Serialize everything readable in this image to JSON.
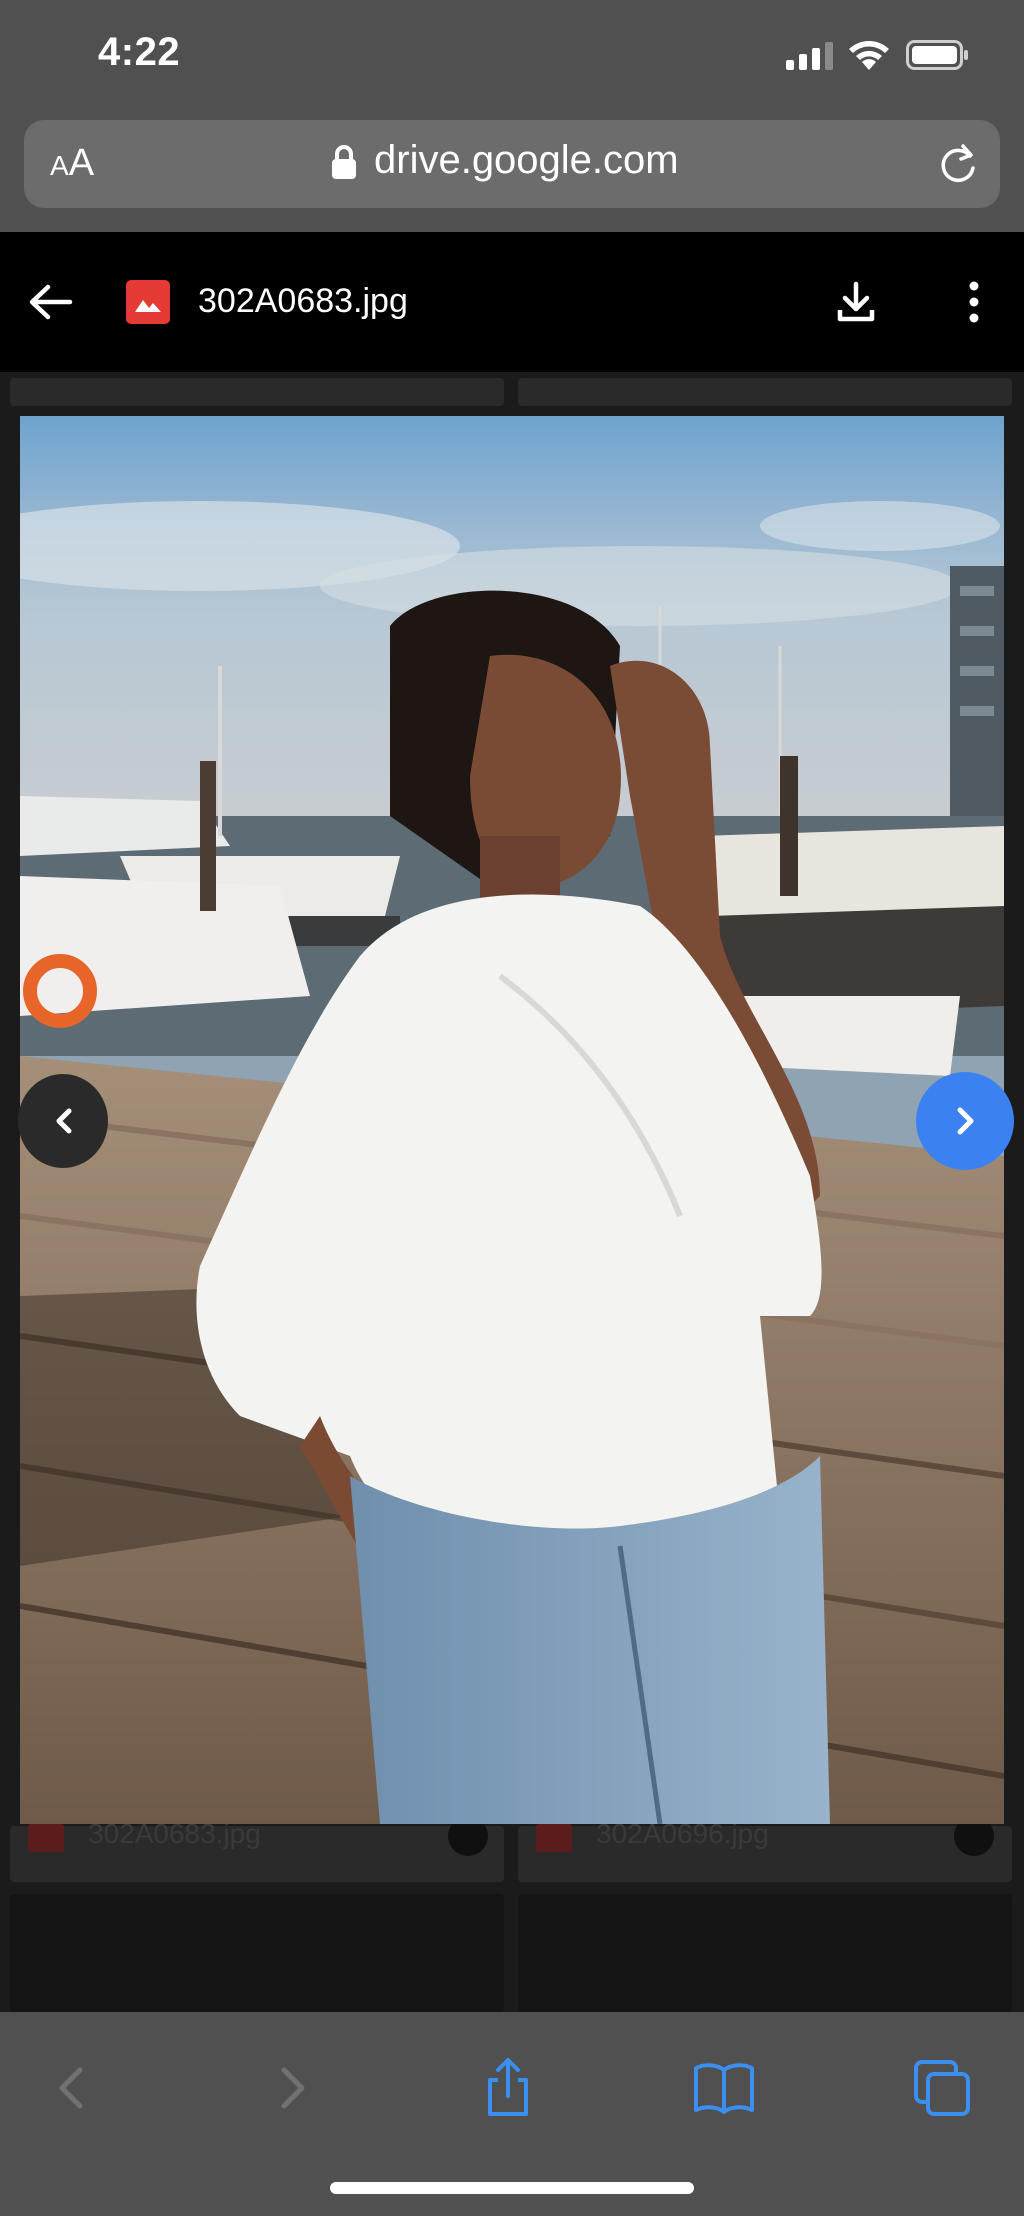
{
  "status_bar": {
    "time": "4:22"
  },
  "address_bar": {
    "aa_label_small": "A",
    "aa_label_large": "A",
    "url": "drive.google.com"
  },
  "header": {
    "file_name": "302A0683.jpg"
  },
  "grid": {
    "left_caption": "302A0683.jpg",
    "right_caption": "302A0696.jpg"
  },
  "icons": {
    "signal": "signal-icon",
    "wifi": "wifi-icon",
    "battery": "battery-icon",
    "lock": "lock-icon",
    "reload": "reload-icon",
    "back": "back-arrow-icon",
    "image_file": "image-file-icon",
    "download": "download-icon",
    "more": "more-vert-icon",
    "prev": "chevron-left-icon",
    "next": "chevron-right-icon",
    "share": "share-icon",
    "bookmarks": "book-icon",
    "tabs": "tabs-icon"
  },
  "colors": {
    "file_icon": "#e33a34",
    "next_button": "#3b82f0",
    "safari_accent": "#3a8ff0",
    "chrome_gray": "#505050"
  }
}
